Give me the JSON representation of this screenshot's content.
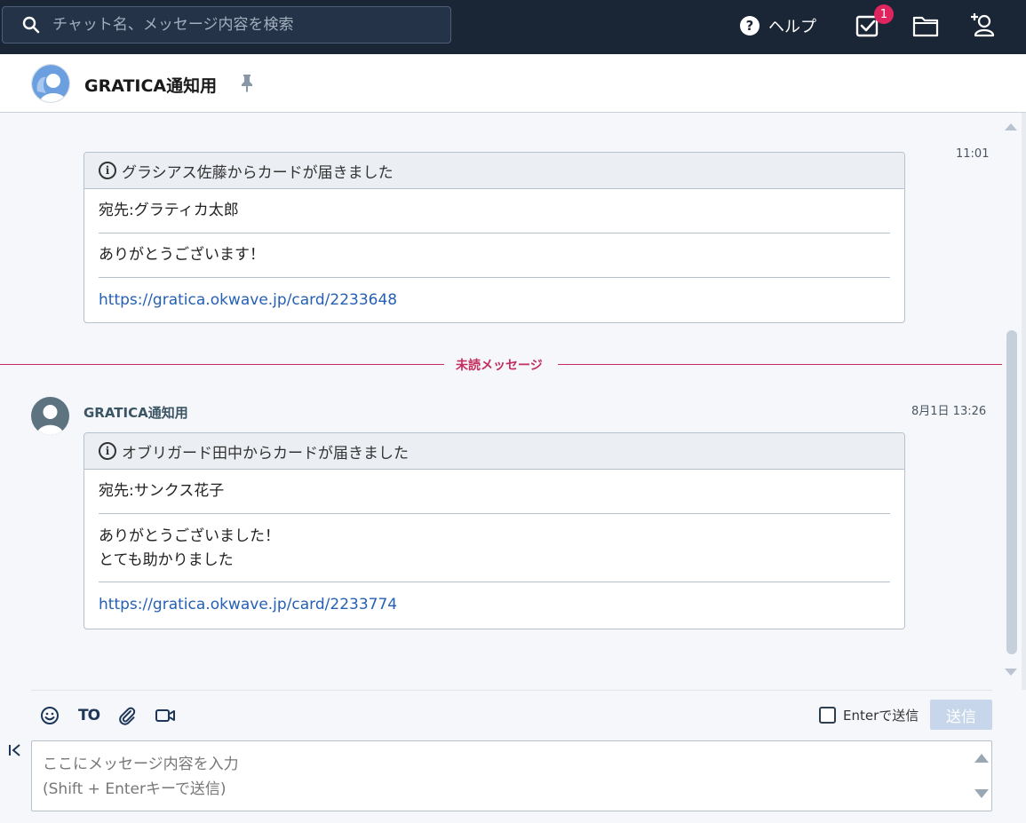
{
  "search": {
    "placeholder": "チャット名、メッセージ内容を検索"
  },
  "header": {
    "help_label": "ヘルプ",
    "task_badge": "1"
  },
  "room": {
    "title": "GRATICA通知用"
  },
  "messages": [
    {
      "time": "11:01",
      "card_title": "グラシアス佐藤からカードが届きました",
      "recipient": "宛先:グラティカ太郎",
      "message_lines": [
        "ありがとうございます！"
      ],
      "link": "https://gratica.okwave.jp/card/2233648"
    },
    {
      "sender": "GRATICA通知用",
      "time": "8月1日 13:26",
      "card_title": "オブリガード田中からカードが届きました",
      "recipient": "宛先:サンクス花子",
      "message_lines": [
        "ありがとうございました！",
        "とても助かりました"
      ],
      "link": "https://gratica.okwave.jp/card/2233774"
    }
  ],
  "unread_label": "未読メッセージ",
  "composer": {
    "to_label": "TO",
    "enter_send_label": "Enterで送信",
    "send_label": "送信",
    "placeholder_line1": "ここにメッセージ内容を入力",
    "placeholder_line2": "(Shift + Enterキーで送信)"
  },
  "colors": {
    "topbar": "#1a2535",
    "unread": "#c42e5e",
    "link": "#2560b5",
    "badge": "#e0245e"
  }
}
